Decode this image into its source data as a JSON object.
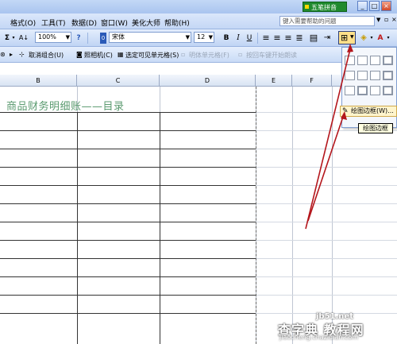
{
  "titlebar": {
    "ime_label": "五笔拼音",
    "min": "_",
    "max": "□",
    "close": "×"
  },
  "menubar": {
    "items": [
      "格式(O)",
      "工具(T)",
      "数据(D)",
      "窗口(W)",
      "美化大师",
      "帮助(H)"
    ],
    "help_placeholder": "键入需要帮助的问题",
    "help_arrow": "▼",
    "doc_min": "_",
    "doc_restore": "▫",
    "doc_close": "×"
  },
  "toolbar": {
    "sigma": "Σ",
    "sort": "A↓",
    "zoom": "100%",
    "help": "?",
    "hash": "0",
    "font": "宋体",
    "size": "12",
    "bold": "B",
    "italic": "I",
    "underline": "U",
    "align_left": "≡",
    "align_center": "≡",
    "align_right": "≡",
    "merge": "▤",
    "font_color": "A"
  },
  "toolbar2": {
    "ungroup": "取消组合(U)",
    "camera": "照相机(C)",
    "select_visible": "选定可见单元格(S)",
    "unlock_cells": "明体单元格(F)",
    "start_reading": "按回车键开始朗读"
  },
  "sheet": {
    "columns": [
      "B",
      "C",
      "D",
      "E",
      "F"
    ],
    "title": "商品财务明细账——目录"
  },
  "border_menu": {
    "draw_borders": "绘图边框(W)...",
    "tooltip": "绘图边框"
  },
  "watermark": {
    "site": "jb51.net",
    "main": "查字典 教程网",
    "url": "jiaocheng.chazidian.com"
  },
  "colors": {
    "title_green": "#5a9a6f",
    "arrow_red": "#b4161c",
    "ime_green": "#1f8a2e"
  }
}
